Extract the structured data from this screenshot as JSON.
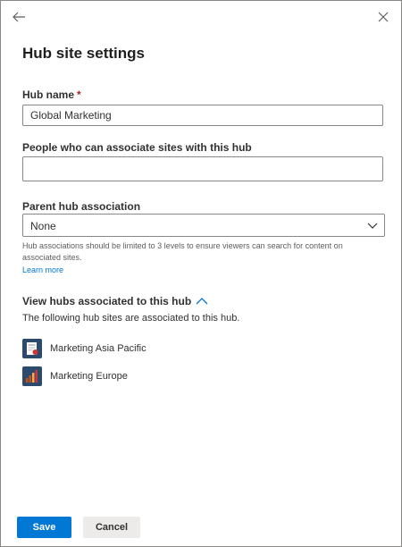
{
  "panel": {
    "title": "Hub site settings"
  },
  "hub_name": {
    "label": "Hub name",
    "required_marker": "*",
    "value": "Global Marketing"
  },
  "associate_people": {
    "label": "People who can associate sites with this hub",
    "value": ""
  },
  "parent_hub": {
    "label": "Parent hub association",
    "selected": "None",
    "help_text": "Hub associations should be limited to 3 levels to ensure viewers can search for content on associated sites.",
    "learn_more": "Learn more"
  },
  "associated_hubs": {
    "toggle_label": "View hubs associated to this hub",
    "description": "The following hub sites are associated to this hub.",
    "items": [
      {
        "name": "Marketing Asia Pacific",
        "icon": "hub-site-icon-doc"
      },
      {
        "name": "Marketing Europe",
        "icon": "hub-site-icon-chart"
      }
    ]
  },
  "footer": {
    "save_label": "Save",
    "cancel_label": "Cancel"
  },
  "colors": {
    "accent": "#0078d4",
    "required": "#a4262c",
    "hub_icon_bg": "#2b4a6e"
  }
}
